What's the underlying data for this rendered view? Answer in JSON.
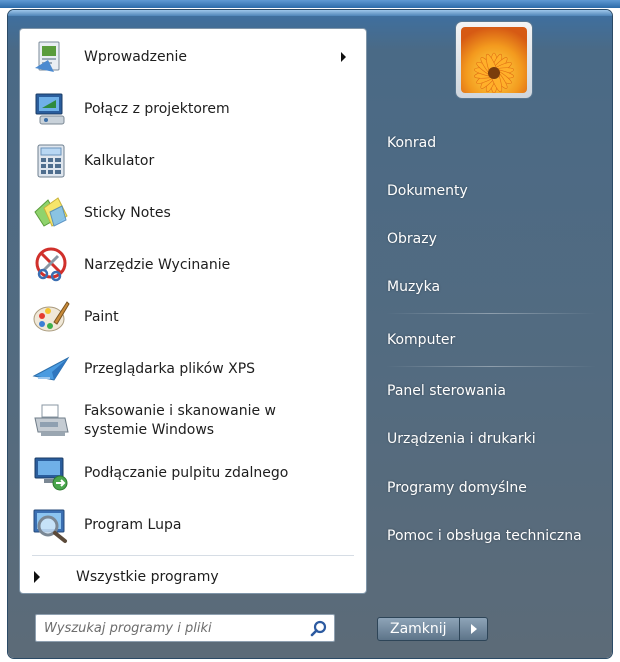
{
  "left": {
    "programs": [
      {
        "label": "Wprowadzenie",
        "icon": "getting-started-icon",
        "has_submenu": true
      },
      {
        "label": "Połącz z projektorem",
        "icon": "projector-icon",
        "has_submenu": false
      },
      {
        "label": "Kalkulator",
        "icon": "calculator-icon",
        "has_submenu": false
      },
      {
        "label": "Sticky Notes",
        "icon": "sticky-notes-icon",
        "has_submenu": false
      },
      {
        "label": "Narzędzie Wycinanie",
        "icon": "snipping-tool-icon",
        "has_submenu": false
      },
      {
        "label": "Paint",
        "icon": "paint-icon",
        "has_submenu": false
      },
      {
        "label": "Przeglądarka plików XPS",
        "icon": "xps-viewer-icon",
        "has_submenu": false
      },
      {
        "label": "Faksowanie i skanowanie w\nsystemie Windows",
        "icon": "fax-scan-icon",
        "has_submenu": false
      },
      {
        "label": "Podłączanie pulpitu zdalnego",
        "icon": "remote-desktop-icon",
        "has_submenu": false
      },
      {
        "label": "Program Lupa",
        "icon": "magnifier-icon",
        "has_submenu": false
      }
    ],
    "all_programs": "Wszystkie programy"
  },
  "search": {
    "placeholder": "Wyszukaj programy i pliki"
  },
  "right": {
    "user_picture": "user-picture-flower",
    "items": [
      {
        "label": "Konrad"
      },
      {
        "label": "Dokumenty"
      },
      {
        "label": "Obrazy"
      },
      {
        "label": "Muzyka"
      },
      {
        "label": "Komputer"
      },
      {
        "label": "Panel sterowania"
      },
      {
        "label": "Urządzenia i drukarki"
      },
      {
        "label": "Programy domyślne"
      },
      {
        "label": "Pomoc i obsługa techniczna"
      }
    ],
    "shutdown_label": "Zamknij"
  },
  "colors": {
    "menu_glass": "#4f6b84",
    "left_panel": "#ffffff",
    "right_text": "#ffffff"
  }
}
